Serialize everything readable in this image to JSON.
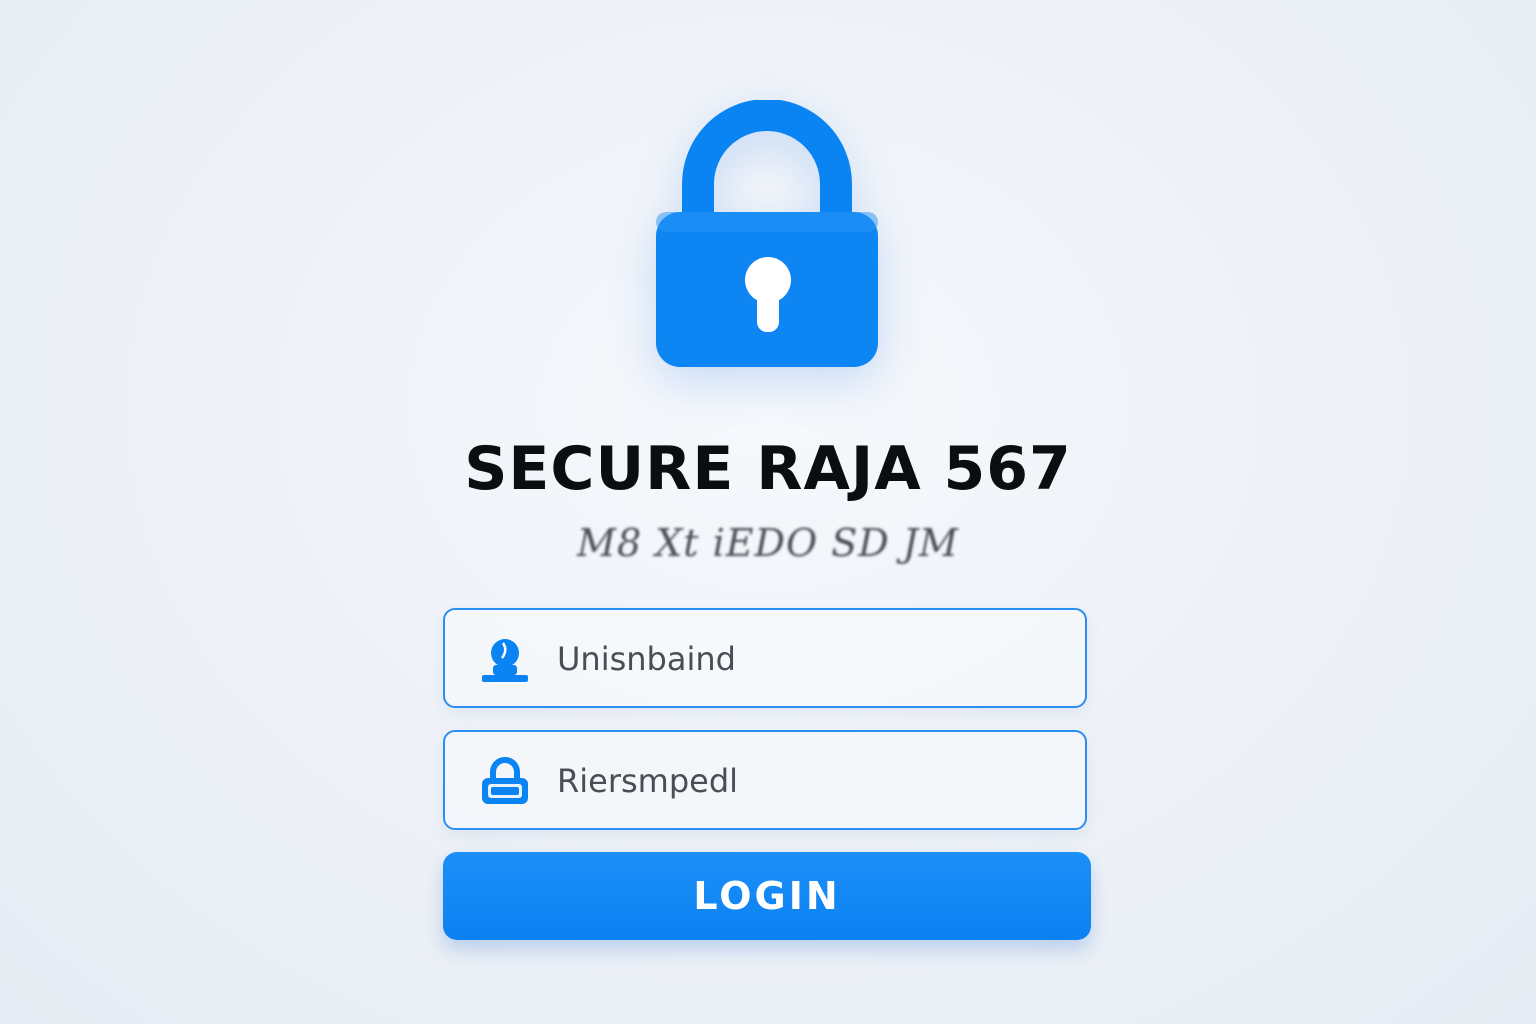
{
  "app": {
    "title": "SECURE RAJA 567",
    "subtitle": "M8 Xt iEDO SD JM"
  },
  "icons": {
    "hero": "padlock-icon",
    "username": "user-icon",
    "password": "lock-icon"
  },
  "form": {
    "username_placeholder": "Unisnbaind",
    "password_placeholder": "Riersmpedl",
    "login_label": "LOGIN"
  },
  "colors": {
    "accent": "#0b84f3",
    "field_border": "#2b8ef2",
    "title": "#0c0d10",
    "background": "#edf1f7"
  }
}
